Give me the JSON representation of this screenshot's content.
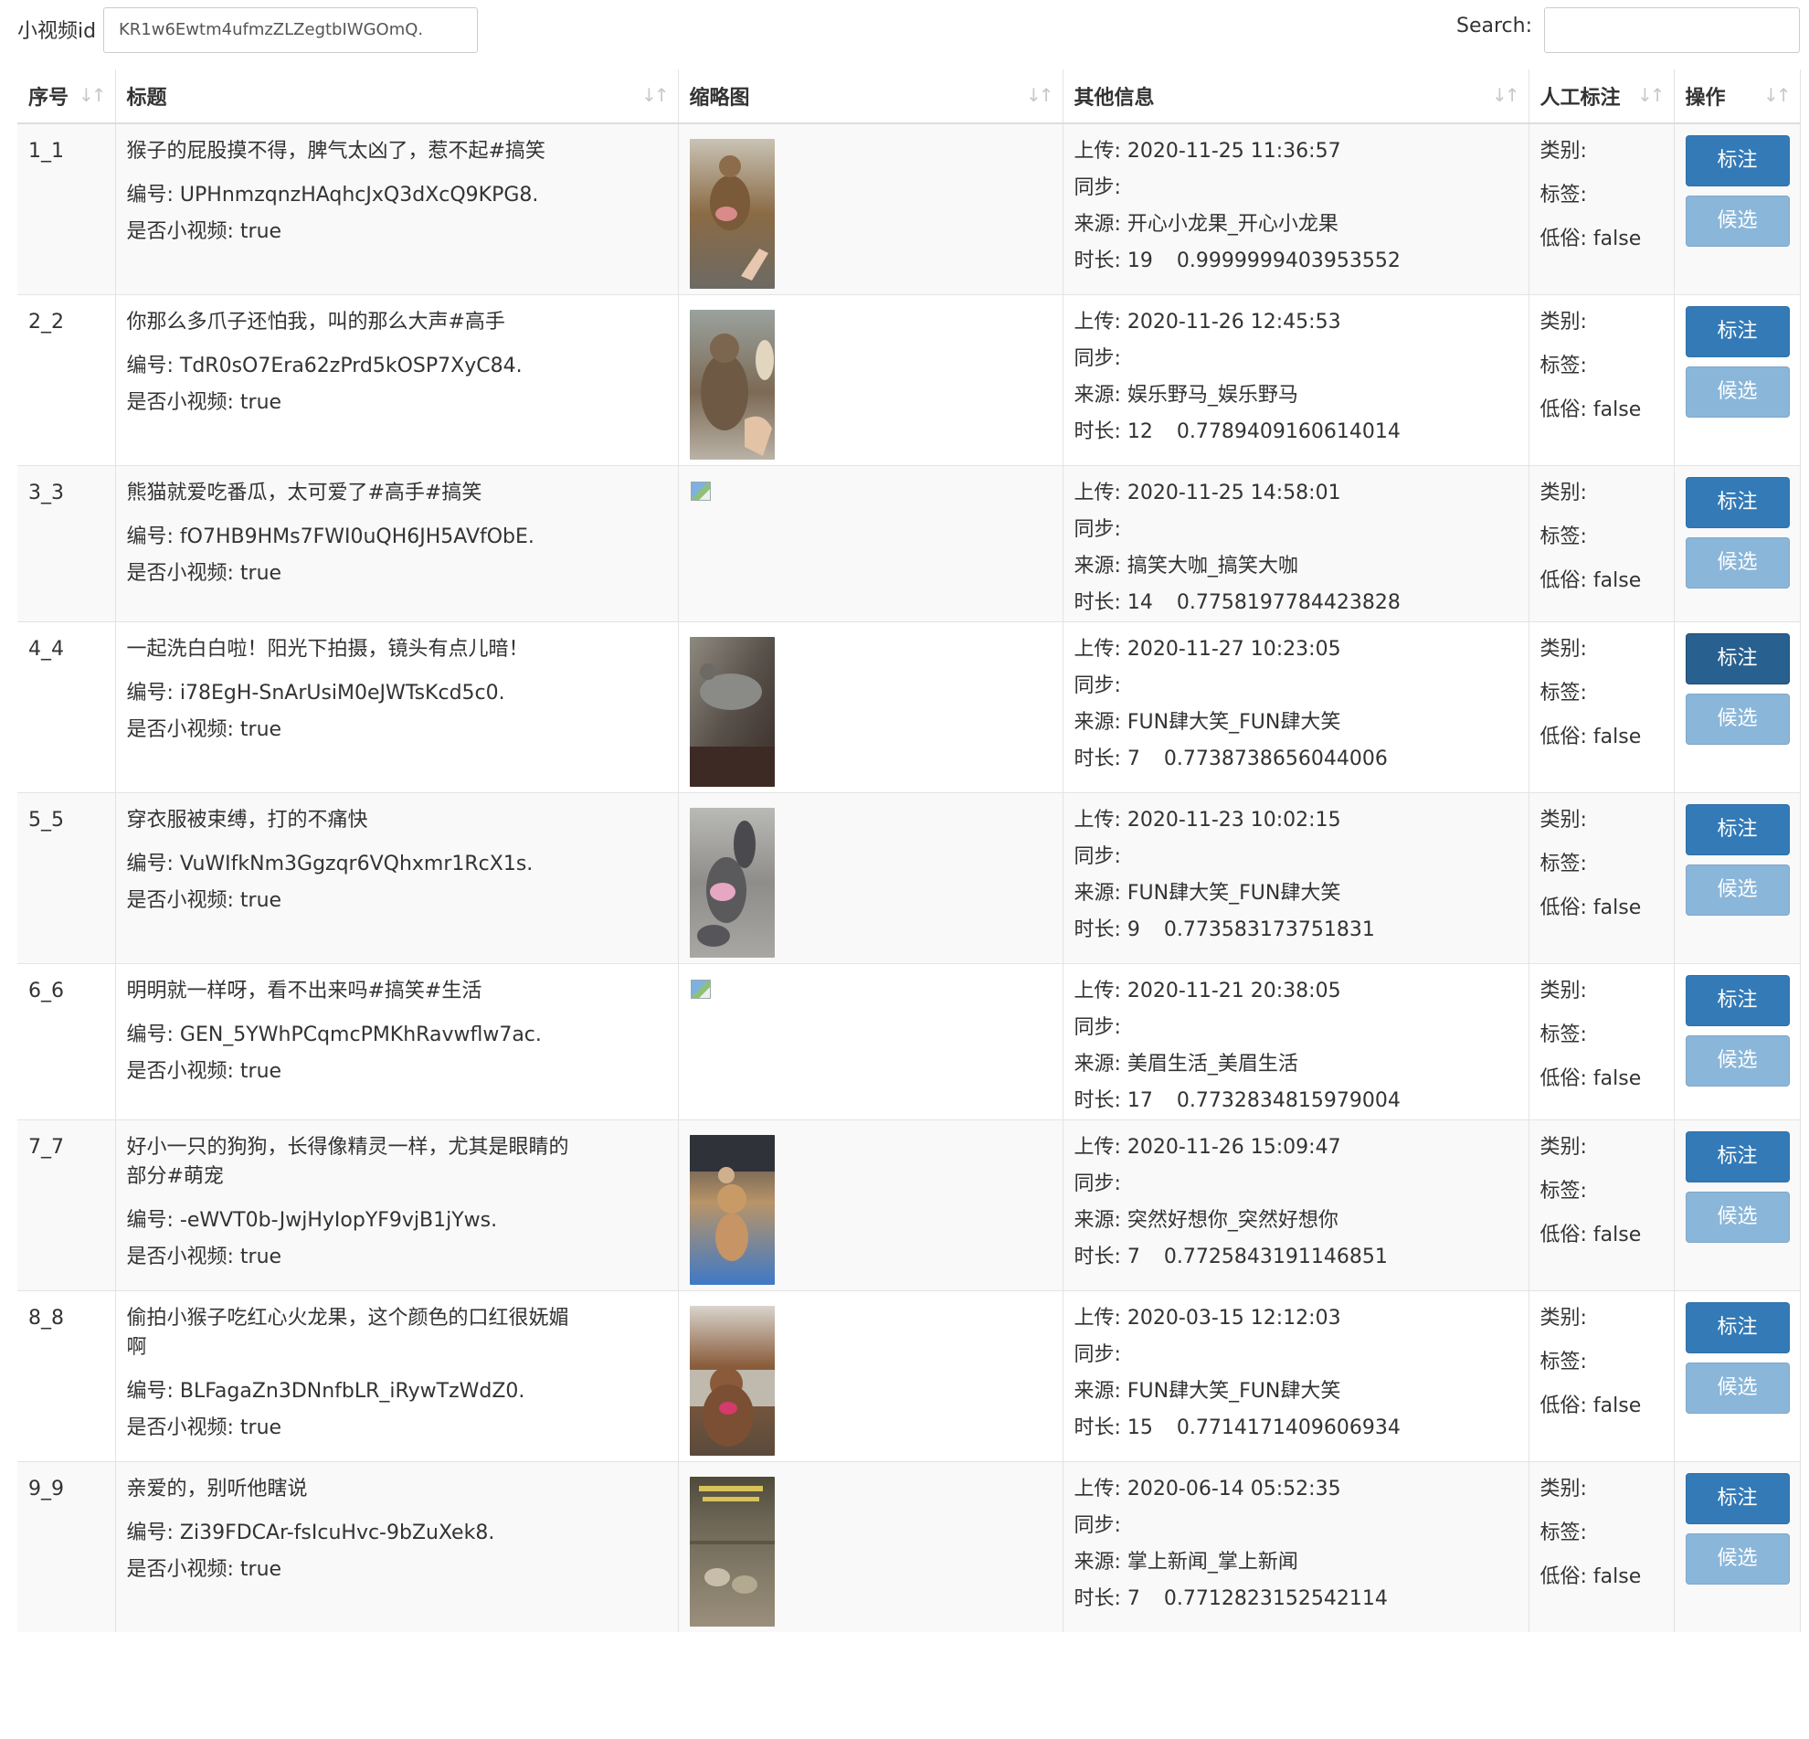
{
  "toolbar": {
    "video_id_label": "小视频id",
    "video_id_value": "KR1w6Ewtm4ufmzZLZegtbIWGOmQ.",
    "search_label": "Search:",
    "search_value": ""
  },
  "table": {
    "headers": [
      "序号",
      "标题",
      "缩略图",
      "其他信息",
      "人工标注",
      "操作"
    ],
    "labels": {
      "id_prefix": "编号: ",
      "is_short_prefix": "是否小视频: ",
      "upload_prefix": "上传: ",
      "sync_prefix": "同步:",
      "source_prefix": "来源: ",
      "duration_prefix": "时长: ",
      "category_label": "类别:",
      "tag_label": "标签:",
      "vulgar_prefix": "低俗: ",
      "mark_button": "标注",
      "candidate_button": "候选"
    },
    "rows": [
      {
        "seq": "1_1",
        "title": "猴子的屁股摸不得，脾气太凶了，惹不起#搞笑",
        "id": "UPHnmzqnzHAqhcJxQ3dXcQ9KPG8.",
        "is_short": "true",
        "thumb": "monkey",
        "upload": "2020-11-25 11:36:57",
        "source": "开心小龙果_开心小龙果",
        "duration": "19",
        "score": "0.9999999403953552",
        "vulgar": "false"
      },
      {
        "seq": "2_2",
        "title": "你那么多爪子还怕我，叫的那么大声#高手",
        "id": "TdR0sO7Era62zPrd5kOSP7XyC84.",
        "is_short": "true",
        "thumb": "marmot",
        "upload": "2020-11-26 12:45:53",
        "source": "娱乐野马_娱乐野马",
        "duration": "12",
        "score": "0.7789409160614014",
        "vulgar": "false"
      },
      {
        "seq": "3_3",
        "title": "熊猫就爱吃番瓜，太可爱了#高手#搞笑",
        "id": "fO7HB9HMs7FWI0uQH6JH5AVfObE.",
        "is_short": "true",
        "thumb": "broken",
        "upload": "2020-11-25 14:58:01",
        "source": "搞笑大咖_搞笑大咖",
        "duration": "14",
        "score": "0.7758197784423828",
        "vulgar": "false"
      },
      {
        "seq": "4_4",
        "title": "一起洗白白啦！阳光下拍摄，镜头有点儿暗！",
        "id": "i78EgH-SnArUsiM0eJWTsKcd5c0.",
        "is_short": "true",
        "thumb": "cat",
        "upload": "2020-11-27 10:23:05",
        "source": "FUN肆大笑_FUN肆大笑",
        "duration": "7",
        "score": "0.7738738656044006",
        "vulgar": "false"
      },
      {
        "seq": "5_5",
        "title": "穿衣服被束缚，打的不痛快",
        "id": "VuWIfkNm3Ggzqr6VQhxmr1RcX1s.",
        "is_short": "true",
        "thumb": "cats",
        "upload": "2020-11-23 10:02:15",
        "source": "FUN肆大笑_FUN肆大笑",
        "duration": "9",
        "score": "0.773583173751831",
        "vulgar": "false"
      },
      {
        "seq": "6_6",
        "title": "明明就一样呀，看不出来吗#搞笑#生活",
        "id": "GEN_5YWhPCqmcPMKhRavwflw7ac.",
        "is_short": "true",
        "thumb": "broken",
        "upload": "2020-11-21 20:38:05",
        "source": "美眉生活_美眉生活",
        "duration": "17",
        "score": "0.7732834815979004",
        "vulgar": "false"
      },
      {
        "seq": "7_7",
        "title": "好小一只的狗狗，长得像精灵一样，尤其是眼睛的部分#萌宠",
        "id": "-eWVT0b-JwjHyIopYF9vjB1jYws.",
        "is_short": "true",
        "thumb": "dog",
        "upload": "2020-11-26 15:09:47",
        "source": "突然好想你_突然好想你",
        "duration": "7",
        "score": "0.7725843191146851",
        "vulgar": "false"
      },
      {
        "seq": "8_8",
        "title": "偷拍小猴子吃红心火龙果，这个颜色的口红很妩媚啊",
        "id": "BLFagaZn3DNnfbLR_iRywTzWdZ0.",
        "is_short": "true",
        "thumb": "monkey2",
        "upload": "2020-03-15 12:12:03",
        "source": "FUN肆大笑_FUN肆大笑",
        "duration": "15",
        "score": "0.7714171409606934",
        "vulgar": "false"
      },
      {
        "seq": "9_9",
        "title": "亲爱的，别听他瞎说",
        "id": "Zi39FDCAr-fsIcuHvc-9bZuXek8.",
        "is_short": "true",
        "thumb": "news",
        "upload": "2020-06-14 05:52:35",
        "source": "掌上新闻_掌上新闻",
        "duration": "7",
        "score": "0.7712823152542114",
        "vulgar": "false"
      }
    ]
  }
}
